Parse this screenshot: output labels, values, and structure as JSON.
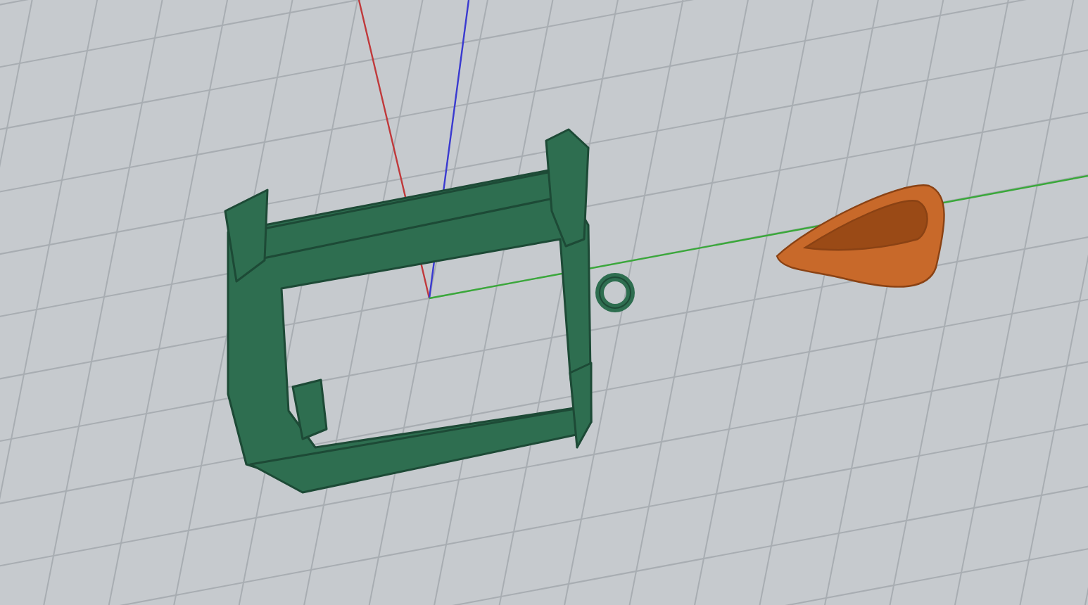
{
  "viewport": {
    "grid": true,
    "axes": true,
    "objects": [
      {
        "kind": "frame",
        "color": "#2e6e50"
      },
      {
        "kind": "bail",
        "color": "#c8692a"
      }
    ]
  }
}
